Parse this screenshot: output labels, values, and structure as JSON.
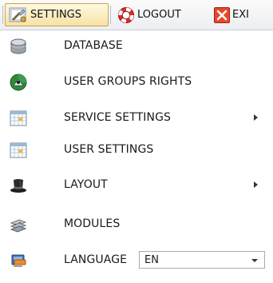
{
  "toolbar": {
    "settings_label": "SETTINGS",
    "logout_label": "LOGOUT",
    "exit_label": "EXI",
    "icons": [
      "settings-wrench-icon",
      "logout-lifebuoy-icon",
      "exit-close-icon"
    ],
    "active_accent": "#f7e2a4"
  },
  "menu": {
    "database": {
      "label": "DATABASE",
      "icon": "database-icon"
    },
    "user_groups_rights": {
      "label": "USER GROUPS RIGHTS",
      "icon": "user-groups-icon"
    },
    "service_settings": {
      "label": "SERVICE SETTINGS",
      "icon": "calendar-grid-icon",
      "has_submenu": true
    },
    "user_settings": {
      "label": "USER SETTINGS",
      "icon": "calendar-grid-icon"
    },
    "layout": {
      "label": "LAYOUT",
      "icon": "top-hat-icon",
      "has_submenu": true
    },
    "modules": {
      "label": "MODULES",
      "icon": "modules-stack-icon"
    },
    "language": {
      "label": "LANGUAGE",
      "icon": "language-monitor-icon",
      "selected": "EN"
    }
  }
}
